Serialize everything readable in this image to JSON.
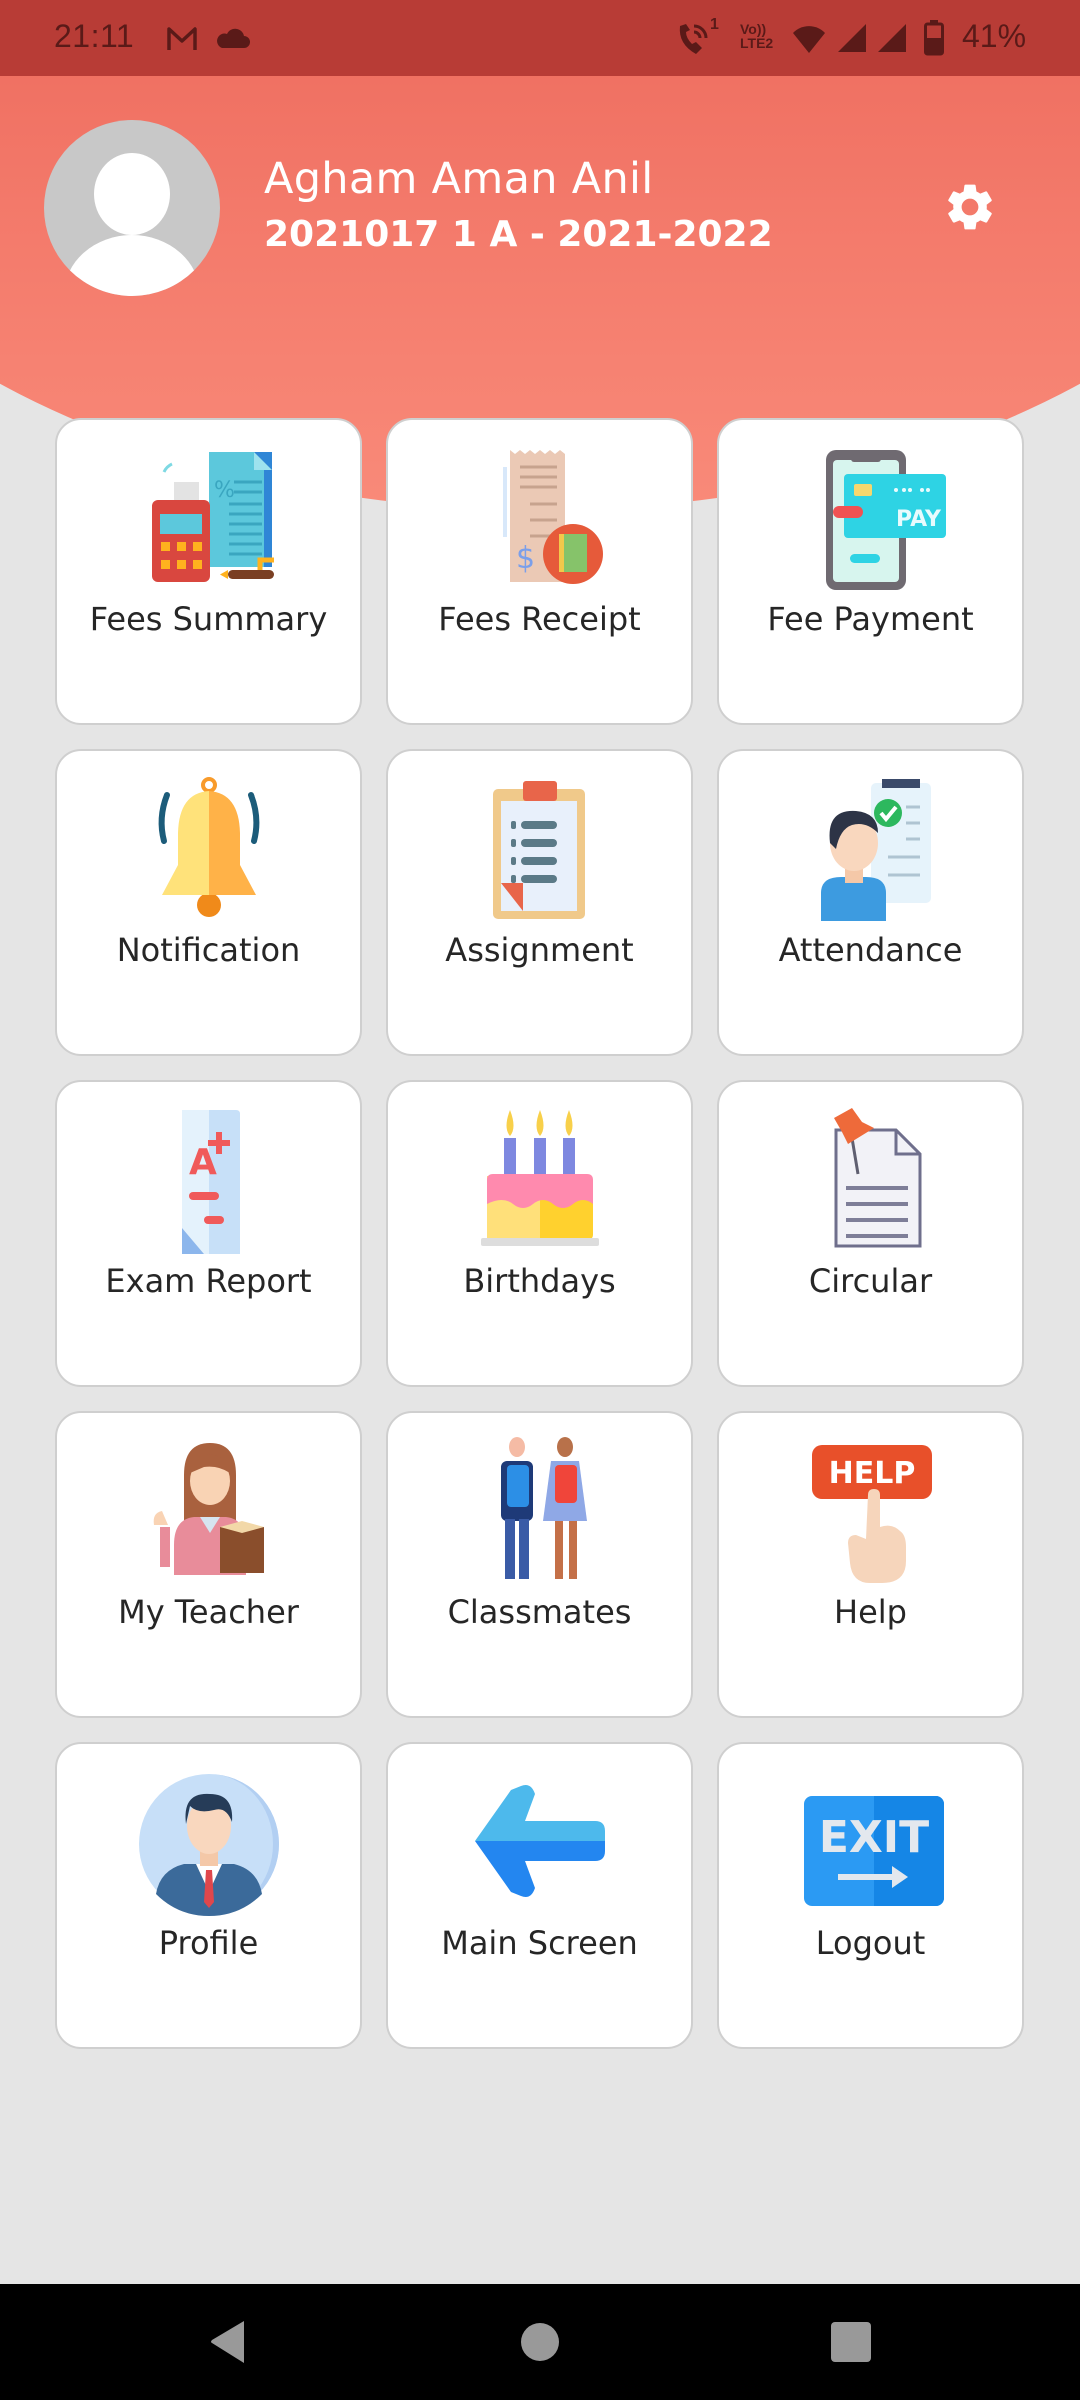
{
  "status_bar": {
    "time": "21:11",
    "notification_icons": [
      "gmail-icon",
      "cloud-icon"
    ],
    "system_icons": [
      "wifi-calling-icon",
      "volte-lte2-icon",
      "wifi-icon",
      "signal-sim1-icon",
      "signal-sim2-icon",
      "battery-icon"
    ],
    "call_badge": "1",
    "volte_top": "Vo))",
    "volte_bottom": "LTE2",
    "battery_percent": "41%"
  },
  "header": {
    "student_name": "Agham Aman Anil",
    "student_meta": "2021017 1 A - 2021-2022",
    "avatar_icon": "default-avatar-icon",
    "settings_icon": "gear-icon"
  },
  "menu": {
    "items": [
      {
        "label": "Fees Summary",
        "icon": "fees-summary-icon"
      },
      {
        "label": "Fees Receipt",
        "icon": "fees-receipt-icon"
      },
      {
        "label": "Fee Payment",
        "icon": "fee-payment-icon"
      },
      {
        "label": "Notification",
        "icon": "bell-icon"
      },
      {
        "label": "Assignment",
        "icon": "clipboard-icon"
      },
      {
        "label": "Attendance",
        "icon": "attendance-icon"
      },
      {
        "label": "Exam Report",
        "icon": "exam-report-icon"
      },
      {
        "label": "Birthdays",
        "icon": "birthday-cake-icon"
      },
      {
        "label": "Circular",
        "icon": "circular-document-icon"
      },
      {
        "label": "My Teacher",
        "icon": "teacher-icon"
      },
      {
        "label": "Classmates",
        "icon": "classmates-icon"
      },
      {
        "label": "Help",
        "icon": "help-icon"
      },
      {
        "label": "Profile",
        "icon": "profile-icon"
      },
      {
        "label": "Main Screen",
        "icon": "back-arrow-icon"
      },
      {
        "label": "Logout",
        "icon": "exit-icon"
      }
    ],
    "icon_text": {
      "pay": "PAY",
      "help": "HELP",
      "exit": "EXIT",
      "grade": "A",
      "dollar": "$"
    }
  },
  "colors": {
    "status_bar": "#B83C36",
    "header_top": "#EE6C5E",
    "header_bottom": "#F98A79",
    "background": "#E5E5E5",
    "card": "#FFFFFF",
    "label_text": "#262626"
  },
  "nav_bar": {
    "buttons": [
      "back",
      "home",
      "recents"
    ]
  }
}
